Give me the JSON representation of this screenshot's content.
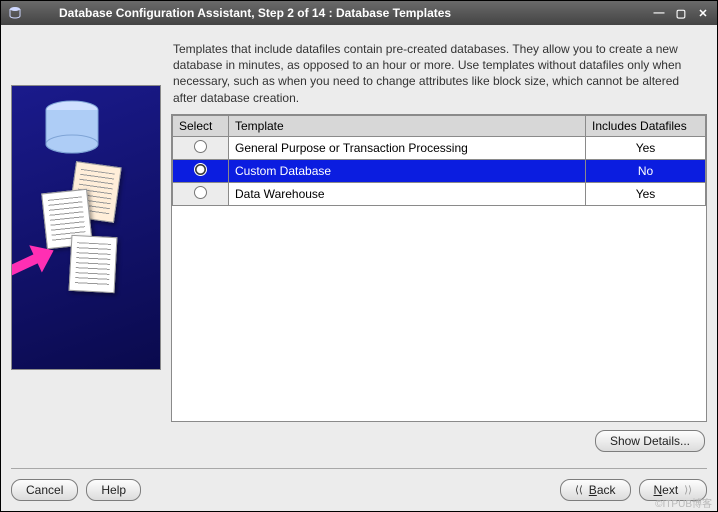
{
  "titlebar": {
    "title": "Database Configuration Assistant, Step 2 of 14 : Database Templates"
  },
  "help_text": "Templates that include datafiles contain pre-created databases. They allow you to create a new database in minutes, as opposed to an hour or more. Use templates without datafiles only when necessary, such as when you need to change attributes like block size, which cannot be altered after database creation.",
  "table": {
    "headers": {
      "select": "Select",
      "template": "Template",
      "includes": "Includes Datafiles"
    },
    "rows": [
      {
        "template": "General Purpose or Transaction Processing",
        "includes": "Yes",
        "selected": false
      },
      {
        "template": "Custom Database",
        "includes": "No",
        "selected": true
      },
      {
        "template": "Data Warehouse",
        "includes": "Yes",
        "selected": false
      }
    ]
  },
  "buttons": {
    "show_details": "Show Details...",
    "cancel": "Cancel",
    "help": "Help",
    "back": "Back",
    "back_key": "B",
    "next": "Next",
    "next_key": "N"
  },
  "watermark": "©ITPUB博客"
}
